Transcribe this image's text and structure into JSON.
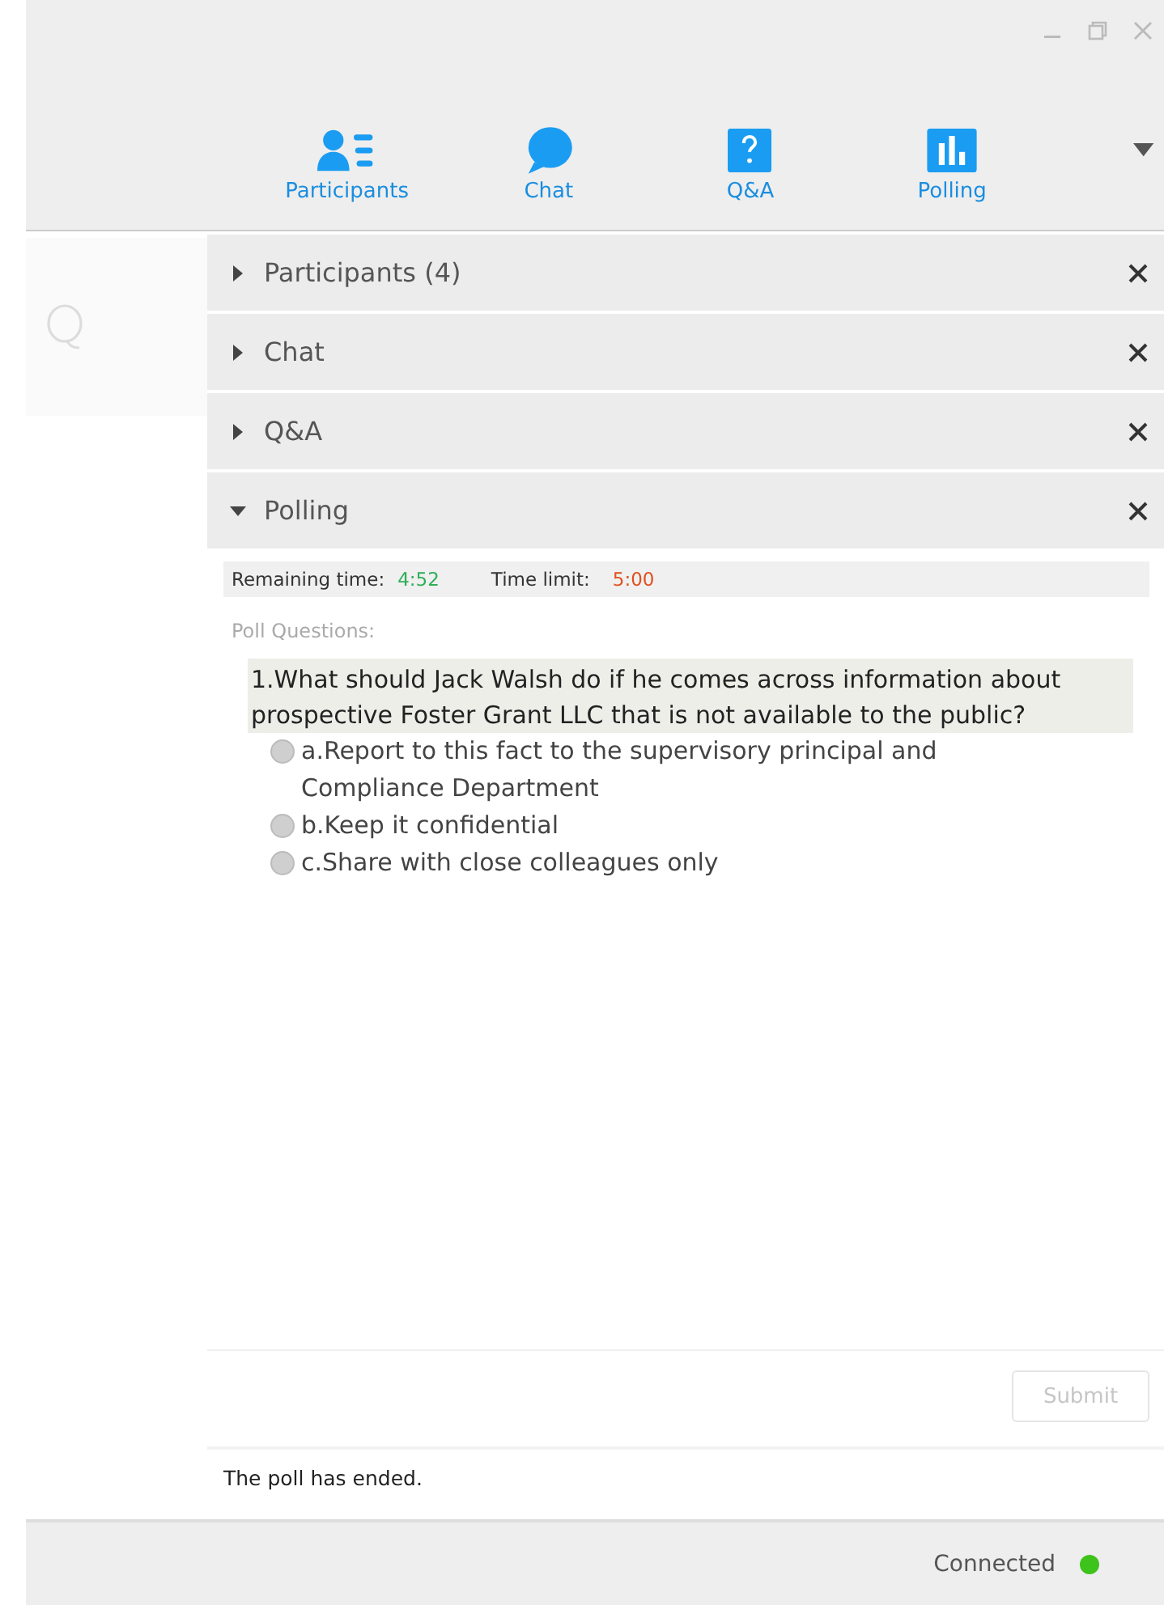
{
  "toolbar": {
    "items": [
      {
        "kind": "participants",
        "label": "Participants"
      },
      {
        "kind": "chat",
        "label": "Chat"
      },
      {
        "kind": "qa",
        "label": "Q&A"
      },
      {
        "kind": "polling",
        "label": "Polling"
      }
    ]
  },
  "sections": [
    {
      "title": "Participants (4)",
      "expanded": false
    },
    {
      "title": "Chat",
      "expanded": false
    },
    {
      "title": "Q&A",
      "expanded": false
    },
    {
      "title": "Polling",
      "expanded": true
    }
  ],
  "poll": {
    "remaining_label": "Remaining time:",
    "remaining": "4:52",
    "limit_label": "Time limit:",
    "limit": "5:00",
    "questions_label": "Poll Questions:",
    "question": "1.What should Jack Walsh do if he comes across information about prospective Foster Grant LLC that is not available to the public?",
    "options": [
      {
        "label": "a.Report to this fact to the supervisory principal and Compliance Department",
        "selected": false
      },
      {
        "label": "b.Keep it confidential",
        "selected": false
      },
      {
        "label": "c.Share with close colleagues only",
        "selected": false
      }
    ],
    "submit": {
      "label": "Submit",
      "disabled": true
    },
    "status": "The poll has ended."
  },
  "status_bar": {
    "text": "Connected",
    "color": "#3ec21c"
  }
}
